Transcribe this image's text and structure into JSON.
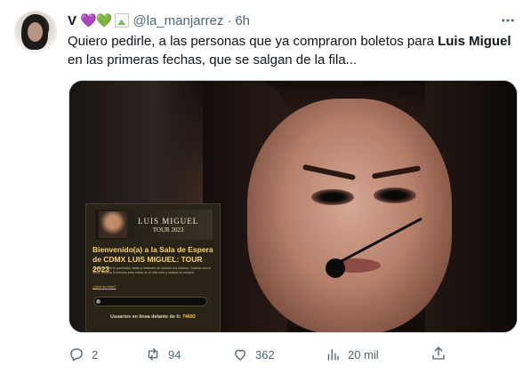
{
  "author": {
    "name": "V",
    "hearts": [
      "💜",
      "💚"
    ],
    "handle": "@la_manjarrez",
    "separator": "·",
    "time": "6h"
  },
  "tweet": {
    "text_before": "Quiero pedirle, a las personas que ya compraron boletos para ",
    "text_bold": "Luis Miguel",
    "text_after": " en las primeras fechas, que se salgan de la fila..."
  },
  "media": {
    "screen": {
      "banner_name": "LUIS MIGUEL",
      "banner_tour": "TOUR 2023",
      "welcome": "Bienvenido(a) a la Sala de Espera de CDMX LUIS MIGUEL: TOUR 2023",
      "fine_print": "Agradecemos tu paciencia, estás a instantes de obtener tus boletos. Cuando sea tu turno, tendrás 5 minutos para entrar en el sitio web y realizar tu compra.",
      "help_link": "¿Qué es esto?",
      "progress": 0.02,
      "queue_label": "Usuarios en línea delante de ti:",
      "queue_number": "74692"
    }
  },
  "actions": {
    "replies": "2",
    "retweets": "94",
    "likes": "362",
    "views": "20 mil"
  },
  "icons": {
    "reply": "reply-icon",
    "retweet": "retweet-icon",
    "like": "heart-icon",
    "views": "views-icon",
    "share": "share-icon",
    "more": "more-icon"
  }
}
